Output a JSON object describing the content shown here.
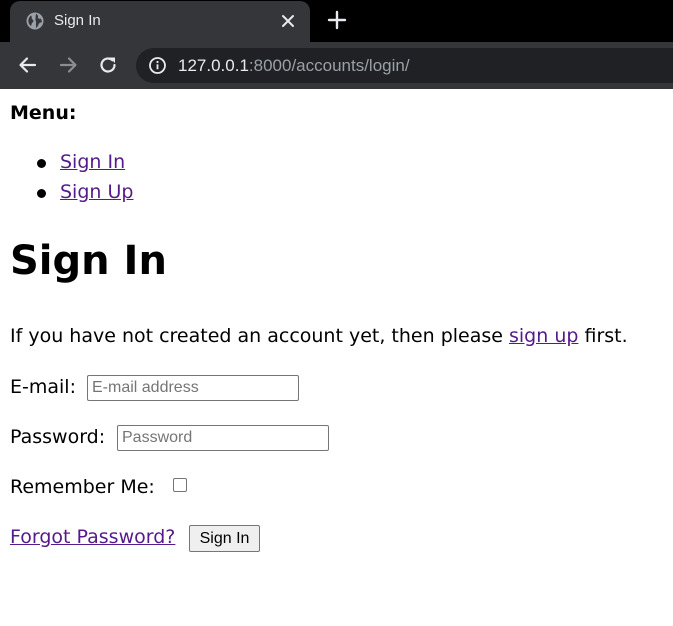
{
  "browser": {
    "tab_title": "Sign In",
    "url_host": "127.0.0.1",
    "url_rest": ":8000/accounts/login/",
    "colors": {
      "tabstrip": "#000000",
      "toolbar": "#35363a",
      "omnibox": "#202124",
      "text": "#e8eaed",
      "muted": "#9aa0a6"
    },
    "icons": [
      "globe-icon",
      "close-icon",
      "plus-icon",
      "back-arrow-icon",
      "forward-arrow-icon",
      "reload-icon",
      "info-icon"
    ]
  },
  "menu": {
    "title": "Menu:",
    "items": [
      {
        "label": "Sign In"
      },
      {
        "label": "Sign Up"
      }
    ]
  },
  "main": {
    "heading": "Sign In",
    "intro_before": "If you have not created an account yet, then please ",
    "intro_link": "sign up",
    "intro_after": " first."
  },
  "form": {
    "email_label": "E-mail:",
    "email_placeholder": "E-mail address",
    "email_value": "",
    "password_label": "Password:",
    "password_placeholder": "Password",
    "password_value": "",
    "remember_label": "Remember Me:",
    "remember_checked": false,
    "forgot_link": "Forgot Password?",
    "submit_label": "Sign In"
  },
  "colors": {
    "link": "#551a8b",
    "text": "#000000",
    "background": "#ffffff"
  }
}
